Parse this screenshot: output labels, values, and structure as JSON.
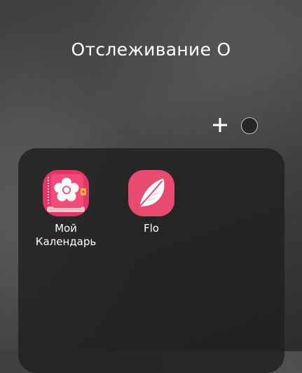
{
  "folder": {
    "title": "Отслеживание О"
  },
  "controls": {
    "add_icon": "plus-icon",
    "color_icon": "color-circle-icon",
    "folder_color": "#262626"
  },
  "apps": [
    {
      "label": "Мой\nКалендарь",
      "icon": "flower-calendar-icon",
      "accent": "#e8326a"
    },
    {
      "label": "Flo",
      "icon": "feather-icon",
      "accent": "#e94a6f"
    }
  ]
}
